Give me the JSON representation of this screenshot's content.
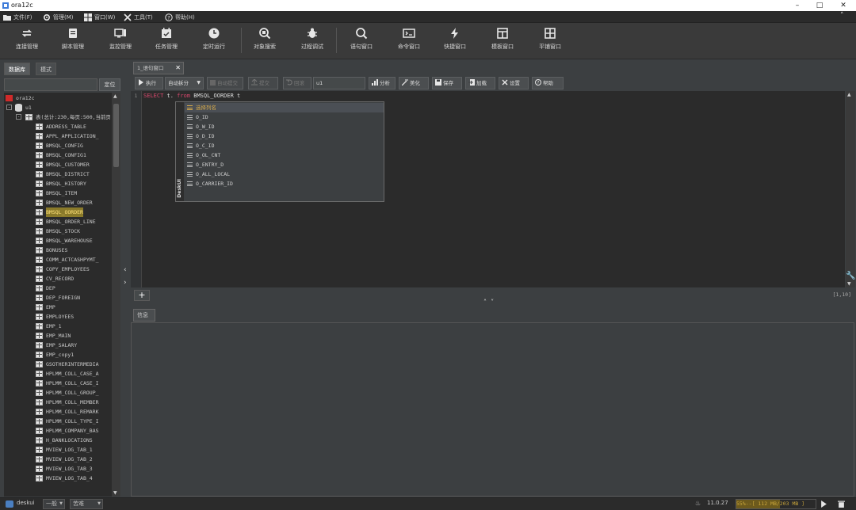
{
  "window": {
    "title": "ora12c"
  },
  "menu": [
    {
      "label": "文件(F)",
      "icon": "folder-icon"
    },
    {
      "label": "管理(M)",
      "icon": "gear-icon"
    },
    {
      "label": "窗口(W)",
      "icon": "windows-icon"
    },
    {
      "label": "工具(T)",
      "icon": "tools-icon"
    },
    {
      "label": "帮助(H)",
      "icon": "help-icon"
    }
  ],
  "toolbar": [
    {
      "label": "连接管理",
      "icon": "connection-icon"
    },
    {
      "label": "脚本管理",
      "icon": "script-icon"
    },
    {
      "label": "监控管理",
      "icon": "monitor-icon"
    },
    {
      "label": "任务管理",
      "icon": "calendar-icon"
    },
    {
      "label": "定时运行",
      "icon": "clock-icon"
    },
    {
      "label": "对象搜索",
      "icon": "object-search-icon"
    },
    {
      "label": "过程调试",
      "icon": "bug-icon"
    },
    {
      "label": "语句窗口",
      "icon": "search-icon"
    },
    {
      "label": "命令窗口",
      "icon": "terminal-icon"
    },
    {
      "label": "快捷窗口",
      "icon": "lightning-icon"
    },
    {
      "label": "模板窗口",
      "icon": "template-icon"
    },
    {
      "label": "平铺窗口",
      "icon": "tile-icon"
    }
  ],
  "left_panel": {
    "tabs": [
      "数据库",
      "模式"
    ],
    "locate_label": "定位",
    "root": "ora12c",
    "schema": "u1",
    "tables_node": "表(总计:230,每页:500,当前页:1)",
    "tables": [
      "ADDRESS_TABLE",
      "APPL_APPLICATION_",
      "BMSQL_CONFIG",
      "BMSQL_CONFIG1",
      "BMSQL_CUSTOMER",
      "BMSQL_DISTRICT",
      "BMSQL_HISTORY",
      "BMSQL_ITEM",
      "BMSQL_NEW_ORDER",
      "BMSQL_OORDER",
      "BMSQL_ORDER_LINE",
      "BMSQL_STOCK",
      "BMSQL_WAREHOUSE",
      "BONUSES",
      "COMM_ACTCASHPYMT_",
      "COPY_EMPLOYEES",
      "CV_RECORD",
      "DEP",
      "DEP_FOREIGN",
      "EMP",
      "EMPLOYEES",
      "EMP_1",
      "EMP_MAIN",
      "EMP_SALARY",
      "EMP_copy1",
      "GSOTHERINTERMEDIA",
      "HPLMM_COLL_CASE_A",
      "HPLMM_COLL_CASE_I",
      "HPLMM_COLL_GROUP_",
      "HPLMM_COLL_MEMBER",
      "HPLMM_COLL_REMARK",
      "HPLMM_COLL_TYPE_I",
      "HPLMM_COMPANY_BAS",
      "H_BANKLOCATIONS",
      "MVIEW_LOG_TAB_1",
      "MVIEW_LOG_TAB_2",
      "MVIEW_LOG_TAB_3",
      "MVIEW_LOG_TAB_4"
    ],
    "selected_table": "BMSQL_OORDER"
  },
  "editor": {
    "tab_label": "1_语句窗口",
    "toolbar": {
      "execute": "执行",
      "auto_split": "自动拆分",
      "auto_commit": "自动提交",
      "commit": "提交",
      "rollback": "回滚",
      "schema": "u1",
      "analyze": "分析",
      "beautify": "美化",
      "save": "保存",
      "load": "加载",
      "settings": "设置",
      "help": "帮助"
    },
    "line_number": "1",
    "code": {
      "kw1": "SELECT",
      "mid": " t. ",
      "kw2": "from",
      "rest": " BMSQL_OORDER t"
    },
    "cursor_pos": "[1,10]",
    "autocomplete": {
      "header": "选择列名",
      "side_label": "DeskUI",
      "items": [
        "O_ID",
        "O_W_ID",
        "O_D_ID",
        "O_C_ID",
        "O_OL_CNT",
        "O_ENTRY_D",
        "O_ALL_LOCAL",
        "O_CARRIER_ID"
      ]
    }
  },
  "info_tab": "信息",
  "statusbar": {
    "user": "deskui",
    "combo1": "一般",
    "combo2": "苦难",
    "version": "11.0.27",
    "memory_text": "55%--[ 112 MB/203 MB ]",
    "memory_fraction": 0.55
  },
  "colors": {
    "keyword": "#cc7832",
    "keyword2": "#d8476d",
    "highlight": "#8a7a2a",
    "popup_header": "#d4a94b"
  }
}
